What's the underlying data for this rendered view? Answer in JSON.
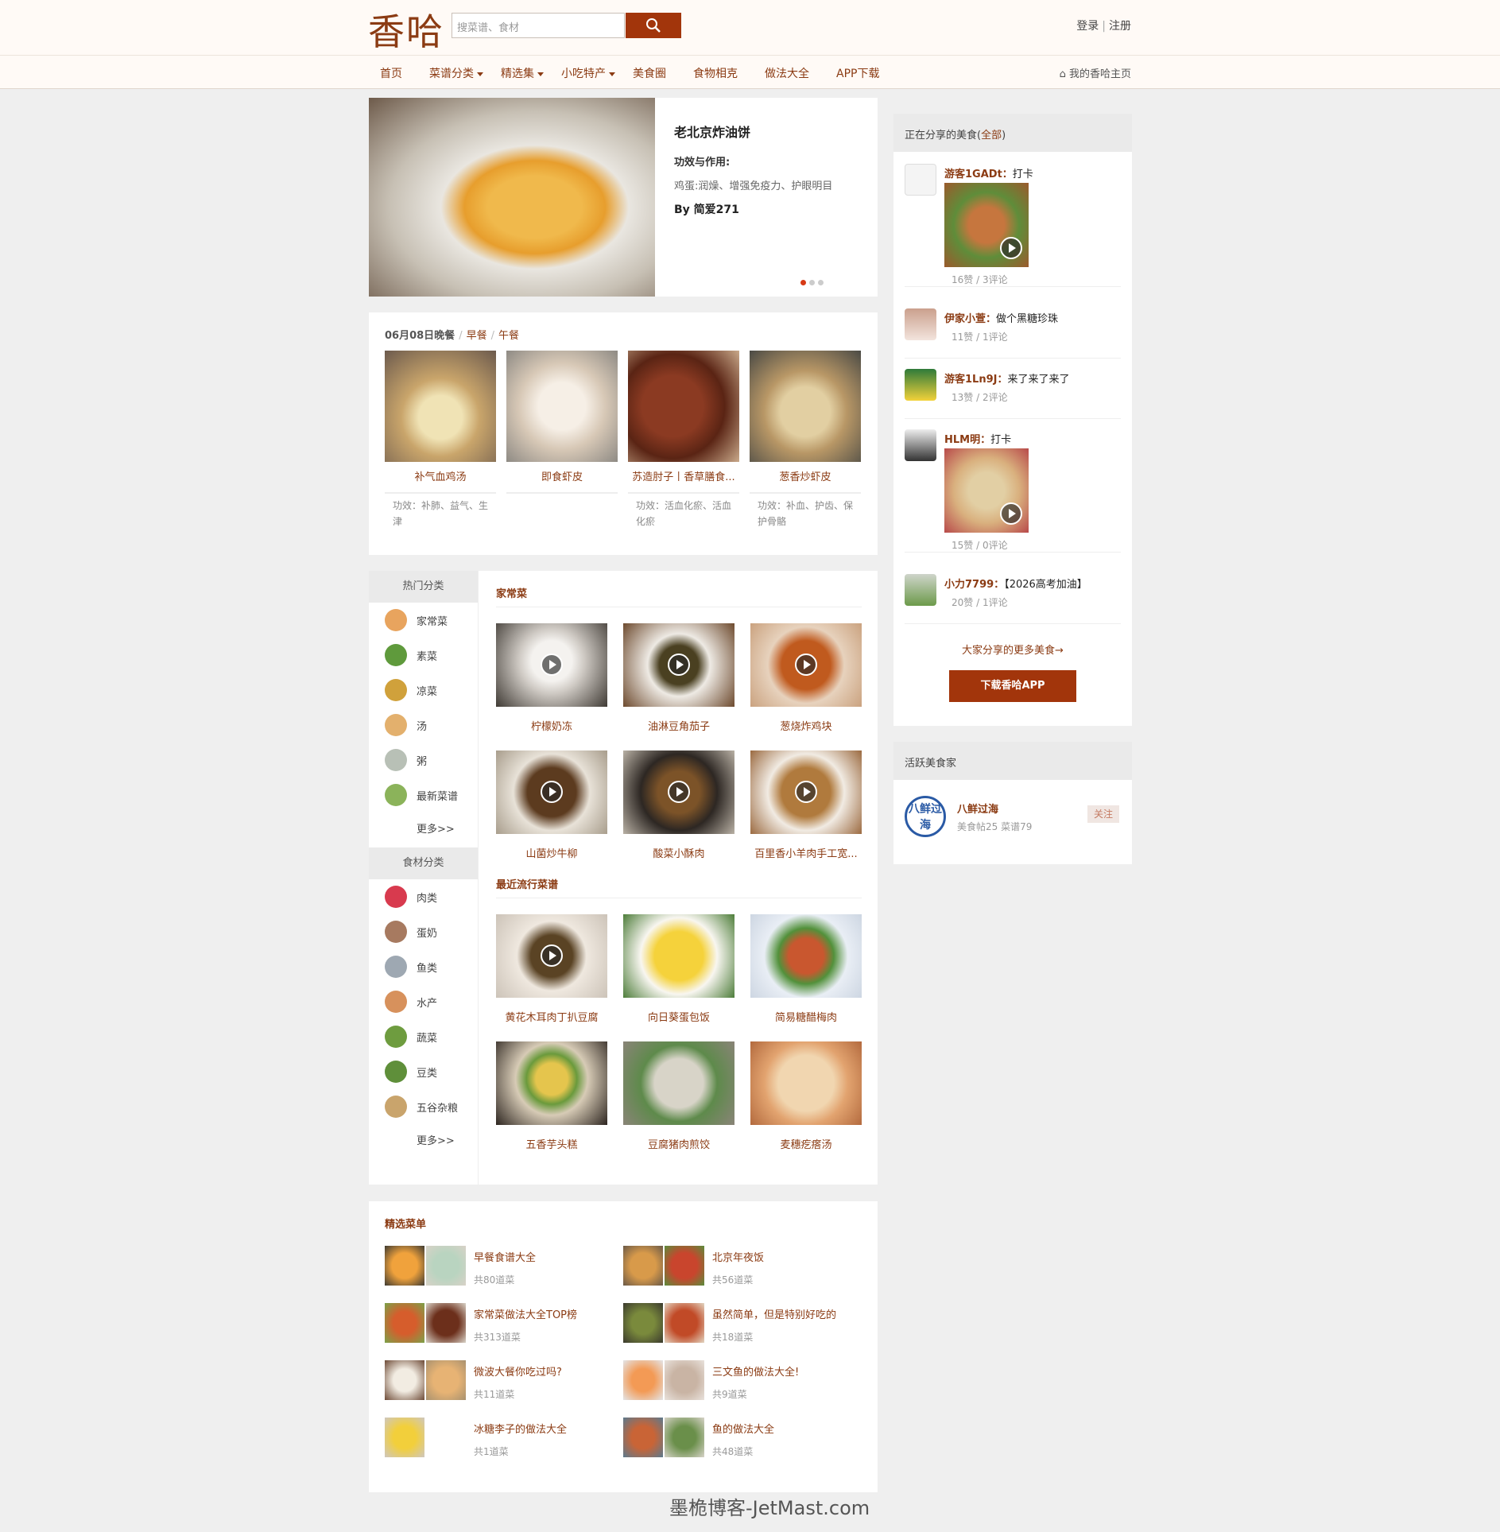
{
  "header": {
    "logo": "香哈",
    "search_placeholder": "搜菜谱、食材",
    "login": "登录",
    "register": "注册"
  },
  "nav": {
    "items": [
      "首页",
      "菜谱分类",
      "精选集",
      "小吃特产",
      "美食圈",
      "食物相克",
      "做法大全",
      "APP下载"
    ],
    "myhome": "我的香哈主页"
  },
  "hero": {
    "title": "老北京炸油饼",
    "label": "功效与作用:",
    "effect": "鸡蛋:润燥、增强免疫力、护眼明目",
    "by": "By 简爱271"
  },
  "meal": {
    "current": "06月08日晚餐",
    "tabs": [
      "早餐",
      "午餐"
    ],
    "items": [
      {
        "name": "补气血鸡汤",
        "effect": "功效：补肺、益气、生津",
        "color": "#d8c39a"
      },
      {
        "name": "即食虾皮",
        "effect": "",
        "color": "#e7ddd2"
      },
      {
        "name": "苏造肘子丨香草膳食...",
        "effect": "功效：活血化瘀、活血化瘀",
        "color": "#7a3522"
      },
      {
        "name": "葱香炒虾皮",
        "effect": "功效：补血、护齿、保护骨骼",
        "color": "#b9a27a"
      }
    ]
  },
  "categories": {
    "hot_title": "热门分类",
    "hot": [
      "家常菜",
      "素菜",
      "凉菜",
      "汤",
      "粥",
      "最新菜谱"
    ],
    "more": "更多>>",
    "food_title": "食材分类",
    "food": [
      "肉类",
      "蛋奶",
      "鱼类",
      "水产",
      "蔬菜",
      "豆类",
      "五谷杂粮"
    ]
  },
  "home_section": {
    "title": "家常菜",
    "items": [
      "柠檬奶冻",
      "油淋豆角茄子",
      "葱烧炸鸡块",
      "山菌炒牛柳",
      "酸菜小酥肉",
      "百里香小羊肉手工宽..."
    ]
  },
  "popular_section": {
    "title": "最近流行菜谱",
    "items": [
      "黄花木耳肉丁扒豆腐",
      "向日葵蛋包饭",
      "简易糖醋梅肉",
      "五香芋头糕",
      "豆腐猪肉煎饺",
      "麦穗疙瘩汤"
    ]
  },
  "menus": {
    "title": "精选菜单",
    "items": [
      {
        "name": "早餐食谱大全",
        "count": "共80道菜"
      },
      {
        "name": "北京年夜饭",
        "count": "共56道菜"
      },
      {
        "name": "家常菜做法大全TOP榜",
        "count": "共313道菜"
      },
      {
        "name": "虽然简单，但是特别好吃的",
        "count": "共18道菜"
      },
      {
        "name": "微波大餐你吃过吗?",
        "count": "共11道菜"
      },
      {
        "name": "三文鱼的做法大全!",
        "count": "共9道菜"
      },
      {
        "name": "冰糖李子的做法大全",
        "count": "共1道菜"
      },
      {
        "name": "鱼的做法大全",
        "count": "共48道菜"
      }
    ]
  },
  "share": {
    "title": "正在分享的美食(",
    "all": "全部",
    "close": ")",
    "items": [
      {
        "user": "游客1GADt：",
        "text": "打卡",
        "meta": "16赞 / 3评论"
      },
      {
        "user": "伊家小萱：",
        "text": "做个黑糖珍珠",
        "meta": "11赞 / 1评论"
      },
      {
        "user": "游客1Ln9J：",
        "text": "来了来了来了",
        "meta": "13赞 / 2评论"
      },
      {
        "user": "HLM明：",
        "text": "打卡",
        "meta": "15赞 / 0评论"
      },
      {
        "user": "小力7799：",
        "text": "【2026高考加油】",
        "meta": "20赞 / 1评论"
      }
    ],
    "more": "大家分享的更多美食→",
    "download": "下载香哈APP"
  },
  "active": {
    "title": "活跃美食家",
    "logo": "八鲜过海",
    "name": "八鲜过海",
    "meta": "美食帖25 菜谱79",
    "follow": "关注"
  },
  "watermark": "墨桅博客-JetMast.com"
}
